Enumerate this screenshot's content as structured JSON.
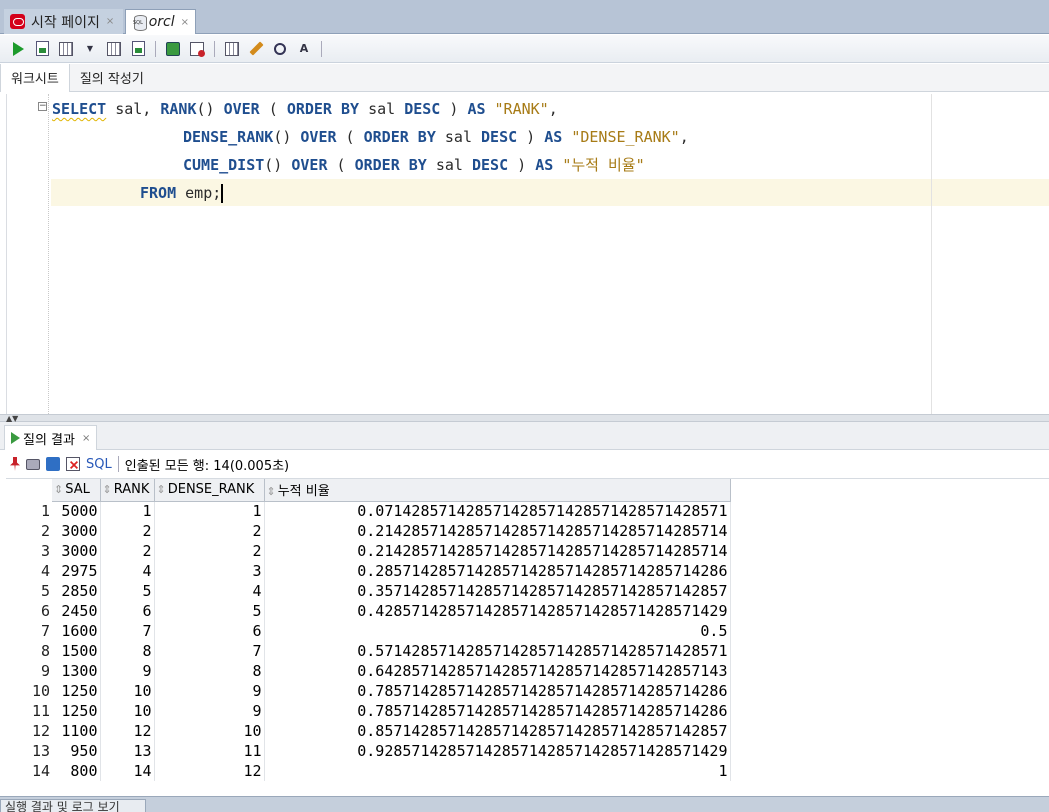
{
  "doc_tabs": [
    {
      "label": "시작 페이지",
      "close": "×"
    },
    {
      "label": "orcl",
      "close": "×"
    }
  ],
  "editor_tabs": [
    "워크시트",
    "질의 작성기"
  ],
  "sql": {
    "line1": {
      "k1": "SELECT",
      "t1": " sal, ",
      "k2": "RANK",
      "t2": "() ",
      "k3": "OVER",
      "t3": " ( ",
      "k4": "ORDER BY",
      "t4": " sal ",
      "k5": "DESC",
      "t5": " ) ",
      "k6": "AS",
      "t6": " ",
      "s1": "\"RANK\"",
      "t7": ","
    },
    "line2": {
      "k1": "DENSE_RANK",
      "t1": "() ",
      "k2": "OVER",
      "t2": " ( ",
      "k3": "ORDER BY",
      "t3": " sal ",
      "k4": "DESC",
      "t4": " ) ",
      "k5": "AS",
      "t5": " ",
      "s1": "\"DENSE_RANK\"",
      "t6": ","
    },
    "line3": {
      "k1": "CUME_DIST",
      "t1": "() ",
      "k2": "OVER",
      "t2": " ( ",
      "k3": "ORDER BY",
      "t3": " sal ",
      "k4": "DESC",
      "t4": " ) ",
      "k5": "AS",
      "t5": " ",
      "s1": "\"누적 비율\""
    },
    "line4": {
      "k1": "FROM",
      "t1": " emp;"
    }
  },
  "results_tab": {
    "label": "질의 결과",
    "close": "×"
  },
  "results_toolbar": {
    "sql_label": "SQL",
    "status": "인출된 모든 행: 14(0.005초)"
  },
  "columns": [
    "SAL",
    "RANK",
    "DENSE_RANK",
    "누적 비율"
  ],
  "rows": [
    [
      "1",
      "5000",
      "1",
      "1",
      "0.071428571428571428571428571428571428571"
    ],
    [
      "2",
      "3000",
      "2",
      "2",
      "0.214285714285714285714285714285714285714"
    ],
    [
      "3",
      "3000",
      "2",
      "2",
      "0.214285714285714285714285714285714285714"
    ],
    [
      "4",
      "2975",
      "4",
      "3",
      "0.285714285714285714285714285714285714286"
    ],
    [
      "5",
      "2850",
      "5",
      "4",
      "0.357142857142857142857142857142857142857"
    ],
    [
      "6",
      "2450",
      "6",
      "5",
      "0.428571428571428571428571428571428571429"
    ],
    [
      "7",
      "1600",
      "7",
      "6",
      "0.5"
    ],
    [
      "8",
      "1500",
      "8",
      "7",
      "0.571428571428571428571428571428571428571"
    ],
    [
      "9",
      "1300",
      "9",
      "8",
      "0.642857142857142857142857142857142857143"
    ],
    [
      "10",
      "1250",
      "10",
      "9",
      "0.785714285714285714285714285714285714286"
    ],
    [
      "11",
      "1250",
      "10",
      "9",
      "0.785714285714285714285714285714285714286"
    ],
    [
      "12",
      "1100",
      "12",
      "10",
      "0.857142857142857142857142857142857142857"
    ],
    [
      "13",
      "950",
      "13",
      "11",
      "0.928571428571428571428571428571428571429"
    ],
    [
      "14",
      "800",
      "14",
      "12",
      "1"
    ]
  ],
  "bottom_tab": "실행 결과 및 로그 보기"
}
